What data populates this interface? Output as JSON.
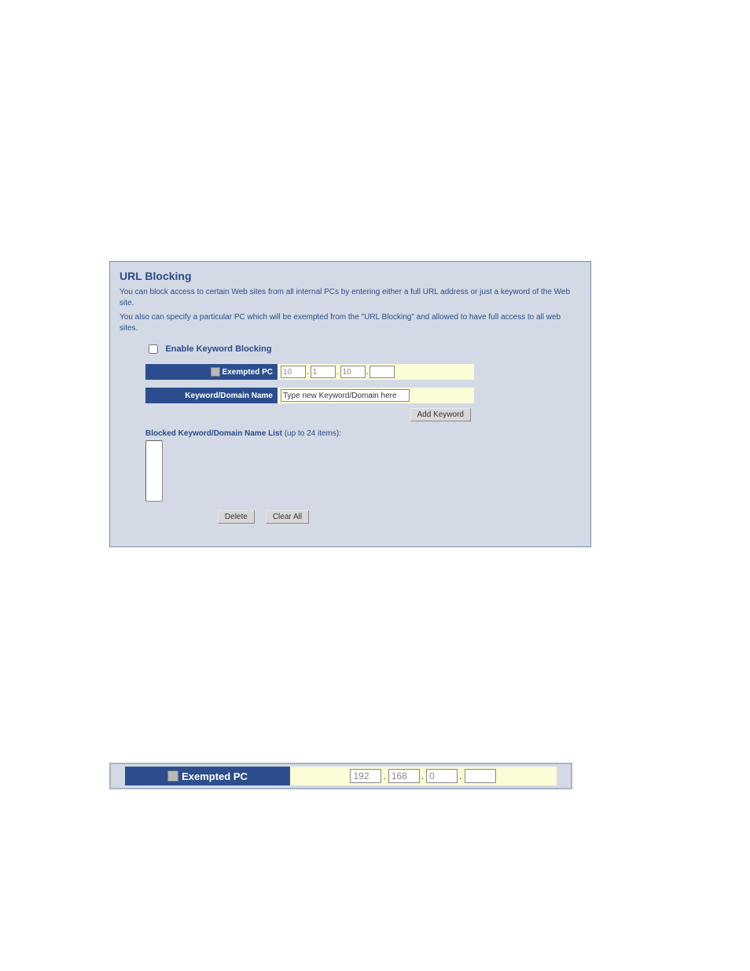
{
  "page": {
    "title": "URL Blocking",
    "description1": "You can block access to certain Web sites from all internal PCs by entering either a full URL address or just a keyword of the Web site.",
    "description2": "You also can specify a particular PC which will be exempted from the \"URL Blocking\" and allowed to have full access to all web sites."
  },
  "enable": {
    "label": "Enable Keyword Blocking",
    "checked": false
  },
  "exempted_pc": {
    "label": "Exempted PC",
    "ip": [
      "10",
      "1",
      "10",
      ""
    ]
  },
  "keyword": {
    "label": "Keyword/Domain Name",
    "placeholder": "Type new Keyword/Domain here"
  },
  "buttons": {
    "add": "Add Keyword",
    "delete": "Delete",
    "clear_all": "Clear All"
  },
  "blocked_list": {
    "label": "Blocked Keyword/Domain Name List",
    "suffix": "(up to 24 items):"
  },
  "detail_panel": {
    "label": "Exempted PC",
    "ip": [
      "192",
      "168",
      "0",
      ""
    ]
  }
}
